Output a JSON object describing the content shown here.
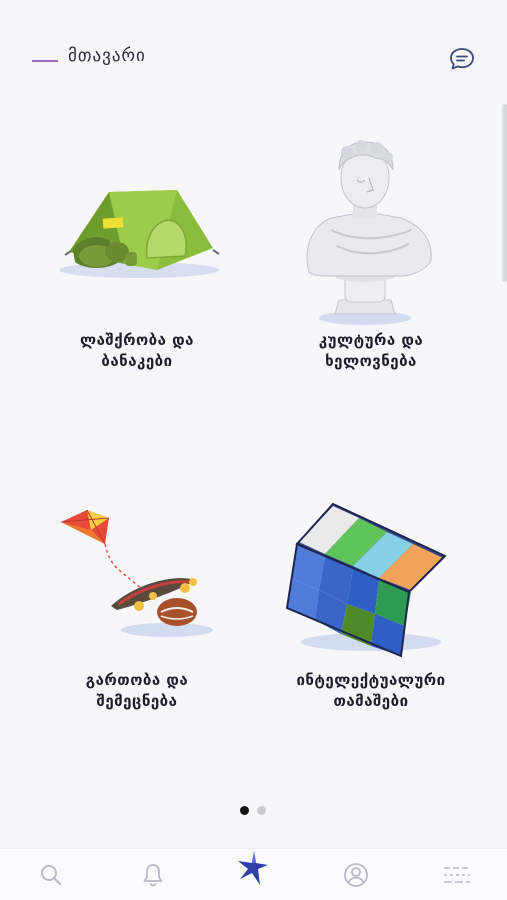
{
  "header": {
    "title": "მთავარი",
    "chat_icon": "chat-bubble-icon"
  },
  "categories": [
    {
      "line1": "ლაშქრობა და",
      "line2": "ბანაკები",
      "icon": "tent-icon"
    },
    {
      "line1": "კულტურა და",
      "line2": "ხელოვნება",
      "icon": "bust-statue-icon"
    },
    {
      "line1": "გართობა და",
      "line2": "შემეცნება",
      "icon": "kite-skateboard-icon"
    },
    {
      "line1": "ინტელექტუალური",
      "line2": "თამაშები",
      "icon": "rubiks-cube-icon"
    }
  ],
  "pagination": {
    "current": 1,
    "total": 2
  },
  "bottom_nav": [
    {
      "icon": "search-icon"
    },
    {
      "icon": "bell-icon"
    },
    {
      "icon": "spinning-top-icon",
      "active": true
    },
    {
      "icon": "profile-icon"
    },
    {
      "icon": "menu-lines-icon"
    }
  ],
  "colors": {
    "accent": "#9b6bc6",
    "nav_active": "#2e3fa8",
    "nav_inactive": "#b9b9c8"
  }
}
